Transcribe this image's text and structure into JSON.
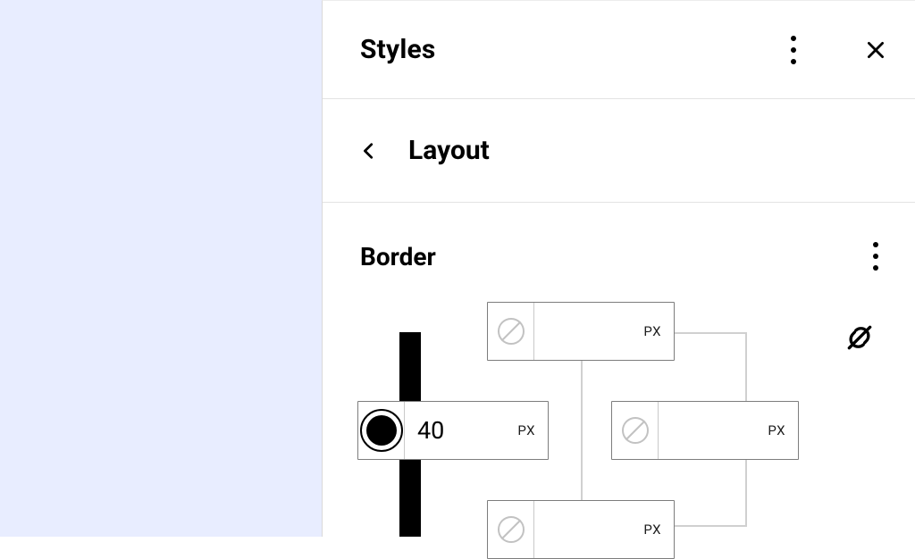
{
  "panel": {
    "title": "Styles",
    "subsection": "Layout",
    "section": "Border"
  },
  "border": {
    "top": {
      "value": "",
      "unit": "PX",
      "has_color": false
    },
    "left": {
      "value": "40",
      "unit": "PX",
      "has_color": true
    },
    "right": {
      "value": "",
      "unit": "PX",
      "has_color": false
    },
    "bottom": {
      "value": "",
      "unit": "PX",
      "has_color": false
    },
    "linked": false
  }
}
